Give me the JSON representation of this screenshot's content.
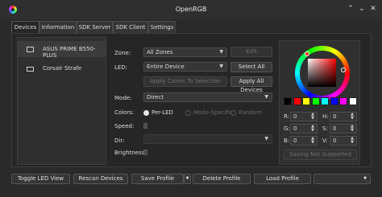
{
  "window": {
    "title": "OpenRGB",
    "controls": [
      "⌃",
      "⌄",
      "✕"
    ]
  },
  "tabs": [
    {
      "label": "Devices",
      "active": true
    },
    {
      "label": "Information",
      "active": false
    },
    {
      "label": "SDK Server",
      "active": false
    },
    {
      "label": "SDK Client",
      "active": false
    },
    {
      "label": "Settings",
      "active": false
    }
  ],
  "devices": [
    {
      "label": "ASUS PRIME B550-PLUS",
      "icon": "motherboard-icon",
      "selected": true
    },
    {
      "label": "Corsair Strafe",
      "icon": "keyboard-icon",
      "selected": false
    }
  ],
  "controls": {
    "zone_label": "Zone:",
    "zone_value": "All Zones",
    "edit_button": "Edit",
    "led_label": "LED:",
    "led_value": "Entire Device",
    "select_all": "Select All",
    "apply_selection": "Apply Colors To Selection",
    "apply_all": "Apply All Devices",
    "mode_label": "Mode:",
    "mode_value": "Direct",
    "colors_label": "Colors:",
    "radio_per_led": "Per-LED",
    "radio_mode_specific": "Mode-Specific",
    "radio_random": "Random",
    "speed_label": "Speed:",
    "dir_label": "Dir:",
    "brightness_label": "Brightness:"
  },
  "color_picker": {
    "swatches": [
      "#000000",
      "#ff0000",
      "#ffff00",
      "#00ff00",
      "#00ffff",
      "#0000ff",
      "#ff00ff",
      "#ffffff"
    ],
    "r_label": "R:",
    "r_value": "0",
    "h_label": "H:",
    "h_value": "0",
    "g_label": "G:",
    "g_value": "0",
    "s_label": "S:",
    "s_value": "0",
    "b_label": "B:",
    "b_value": "0",
    "v_label": "V:",
    "v_value": "0",
    "save_button": "Saving Not Supported"
  },
  "footer": {
    "toggle_led_view": "Toggle LED View",
    "rescan": "Rescan Devices",
    "save_profile": "Save Profile",
    "delete_profile": "Delete Profile",
    "load_profile": "Load Profile",
    "profile_select": ""
  }
}
